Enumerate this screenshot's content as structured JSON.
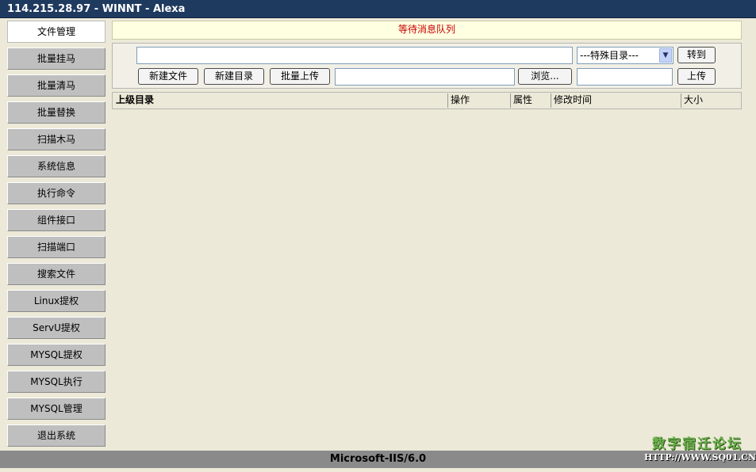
{
  "window": {
    "title": "114.215.28.97 - WINNT - Alexa"
  },
  "sidebar": {
    "items": [
      {
        "label": "文件管理",
        "active": true
      },
      {
        "label": "批量挂马"
      },
      {
        "label": "批量清马"
      },
      {
        "label": "批量替换"
      },
      {
        "label": "扫描木马"
      },
      {
        "label": "系统信息"
      },
      {
        "label": "执行命令"
      },
      {
        "label": "组件接口"
      },
      {
        "label": "扫描端口"
      },
      {
        "label": "搜索文件"
      },
      {
        "label": "Linux提权"
      },
      {
        "label": "ServU提权"
      },
      {
        "label": "MYSQL提权"
      },
      {
        "label": "MYSQL执行"
      },
      {
        "label": "MYSQL管理"
      },
      {
        "label": "退出系统"
      }
    ]
  },
  "message": {
    "text": "等待消息队列",
    "color": "#c80000"
  },
  "toolbar": {
    "path_value": "",
    "special_dir_selected": "---特殊目录---",
    "goto_label": "转到",
    "new_file_label": "新建文件",
    "new_dir_label": "新建目录",
    "batch_upload_label": "批量上传",
    "upload_file_value": "",
    "browse_label": "浏览...",
    "upload_name_value": "",
    "upload_label": "上传"
  },
  "file_table": {
    "columns": [
      "上级目录",
      "操作",
      "属性",
      "修改时间",
      "大小"
    ]
  },
  "status": {
    "server": "Microsoft-IIS/6.0"
  },
  "watermark": {
    "line1": "数字宿迁论坛",
    "line2": "HTTP://WWW.SQ01.CN"
  },
  "colors": {
    "titlebar": "#1f3a5f",
    "background": "#ece9d8",
    "message_bg": "#ffffe1"
  },
  "icons": {
    "select_arrow": "chevron-down-icon"
  }
}
